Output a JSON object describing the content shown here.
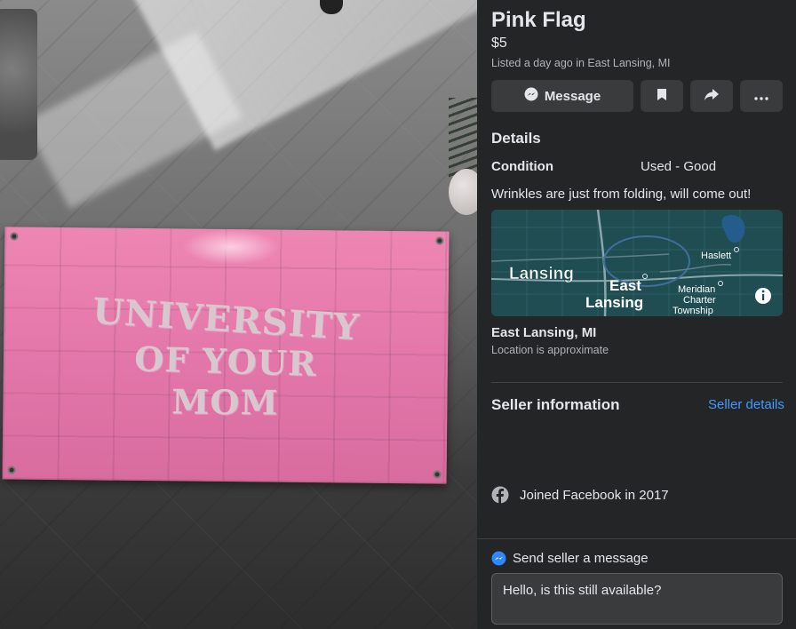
{
  "listing": {
    "title": "Pink Flag",
    "price": "$5",
    "listed": "Listed a day ago in East Lansing, MI"
  },
  "photo": {
    "flag_lines": [
      "UNIVERSITY",
      "OF YOUR",
      "MOM"
    ]
  },
  "actions": {
    "message_label": "Message",
    "save_icon": "bookmark-icon",
    "share_icon": "share-icon",
    "more_icon": "more-icon"
  },
  "details": {
    "heading": "Details",
    "condition_label": "Condition",
    "condition_value": "Used - Good",
    "description": "Wrinkles are just from folding, will come out!"
  },
  "map": {
    "labels": {
      "lansing": "Lansing",
      "east": "East",
      "lansing2": "Lansing",
      "haslett": "Haslett",
      "meridian": "Meridian",
      "charter": "Charter",
      "township": "Township"
    },
    "info_icon": "info-icon"
  },
  "location": {
    "name": "East Lansing, MI",
    "note": "Location is approximate"
  },
  "seller": {
    "heading": "Seller information",
    "details_link": "Seller details",
    "joined": "Joined Facebook in 2017"
  },
  "send": {
    "label": "Send seller a message",
    "message": "Hello, is this still available?"
  },
  "colors": {
    "sidebar_bg": "#242526",
    "button_bg": "#3a3b3c",
    "link": "#4599ff",
    "flag_pink": "#e377aa"
  }
}
